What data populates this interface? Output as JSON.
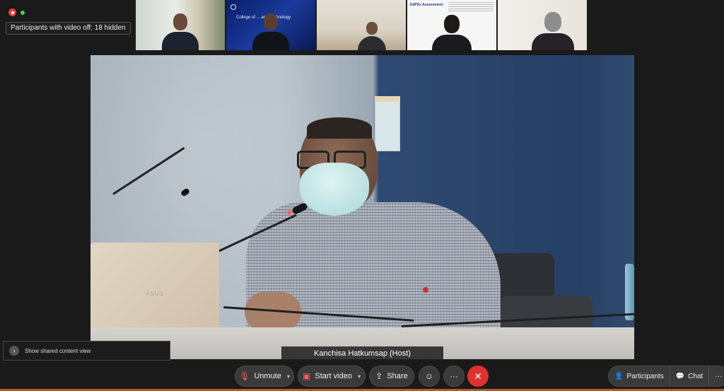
{
  "status": {
    "hidden_participants": "Participants with video off: 18 hidden"
  },
  "thumbnails": [
    {
      "id": "p1",
      "label": ""
    },
    {
      "id": "p2",
      "slide_text": "College of ... and Technology"
    },
    {
      "id": "p3",
      "label": ""
    },
    {
      "id": "p4",
      "slide_header": "EdPEx Assessment"
    },
    {
      "id": "p5",
      "label": ""
    }
  ],
  "main": {
    "speaker_name": "Kanchisa Hatkumsap (Host)",
    "laptop_brand": "ASUS"
  },
  "tip": {
    "text": "Show shared content view"
  },
  "toolbar": {
    "unmute": "Unmute",
    "start_video": "Start video",
    "share": "Share",
    "reactions_icon": "smile-icon",
    "more_icon": "ellipsis-icon",
    "leave_icon": "x-icon",
    "participants": "Participants",
    "chat": "Chat"
  },
  "colors": {
    "background": "#1a1a1a",
    "leave": "#e0312f",
    "muted_icon": "#ff5a5a",
    "recording": "#e04040",
    "live": "#4bd34b"
  }
}
